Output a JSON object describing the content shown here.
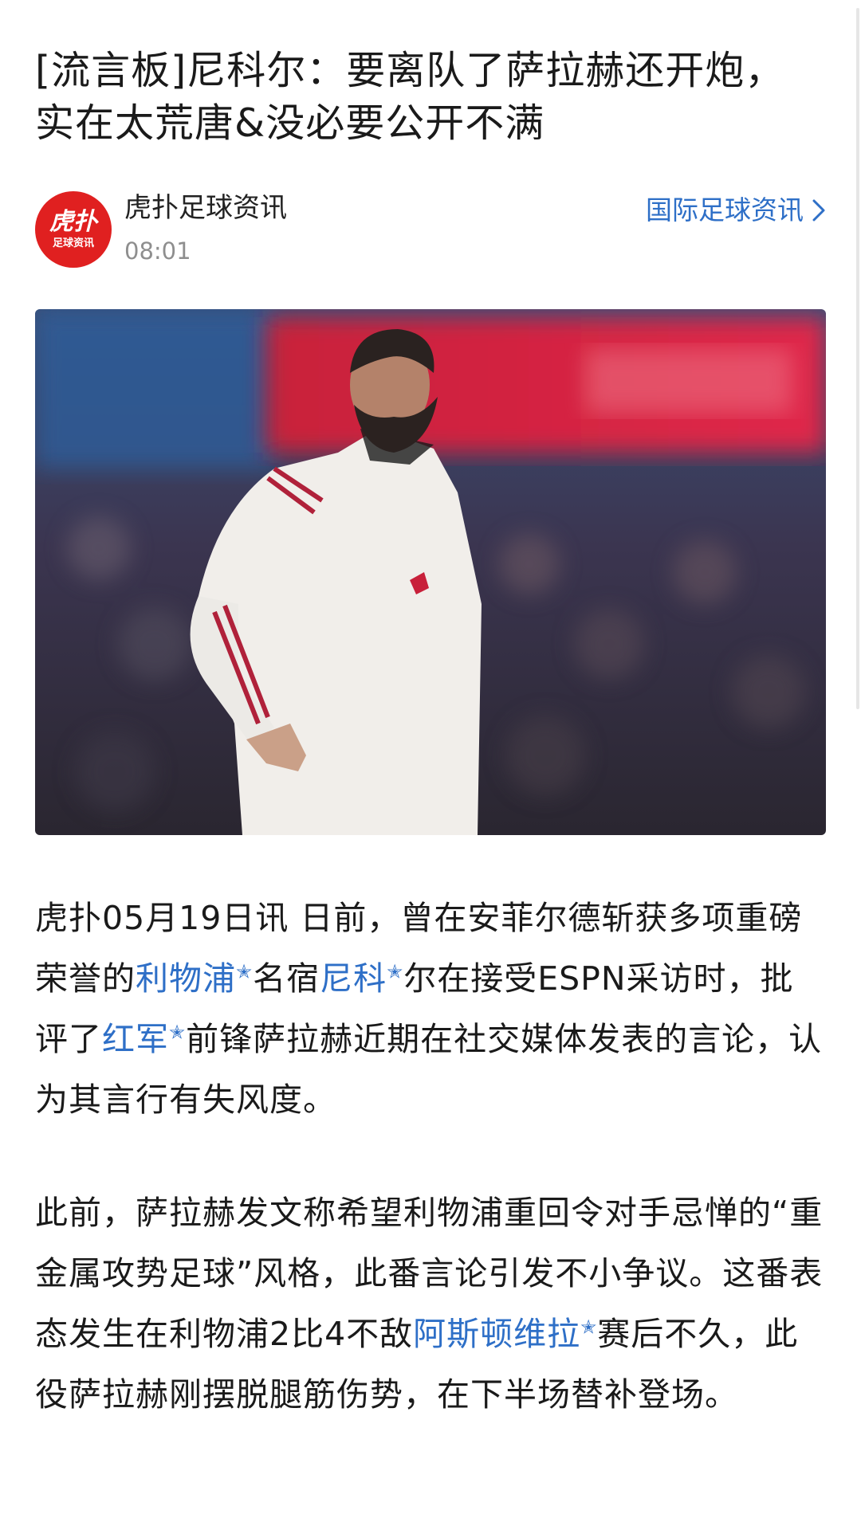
{
  "article": {
    "title_line1": "[流言板]尼科尔：要离队了萨拉赫还开炮，",
    "title_line2": "实在太荒唐&没必要公开不满"
  },
  "author": {
    "avatar_main": "虎扑",
    "avatar_sub": "足球资讯",
    "name": "虎扑足球资讯",
    "time": "08:01",
    "channel_link": "国际足球资讯",
    "channel_icon": "chevron-right-icon"
  },
  "paragraph1": {
    "t1": "虎扑05月19日讯 日前，曾在安菲尔德斩获多项重磅荣誉的",
    "k1": "利物浦",
    "t2": "名宿",
    "k2": "尼科",
    "t3": "尔在接受ESPN采访时，批评了",
    "k3": "红军",
    "t4": "前锋萨拉赫近期在社交媒体发表的言论，认为其言行有失风度。"
  },
  "paragraph2": {
    "t1": "此前，萨拉赫发文称希望利物浦重回令对手忌惮的“重金属攻势足球”风格，此番言论引发不小争议。这番表态发生在利物浦2比4不敌",
    "k1": "阿斯顿维拉",
    "t2": "赛后不久，此役萨拉赫刚摆脱腿筋伤势，在下半场替补登场。"
  },
  "keyword_marker": "✭",
  "colors": {
    "link": "#2e6fc7",
    "avatar_bg": "#e02020",
    "meta_gray": "#8e8e8e",
    "text": "#1a1a1a"
  }
}
